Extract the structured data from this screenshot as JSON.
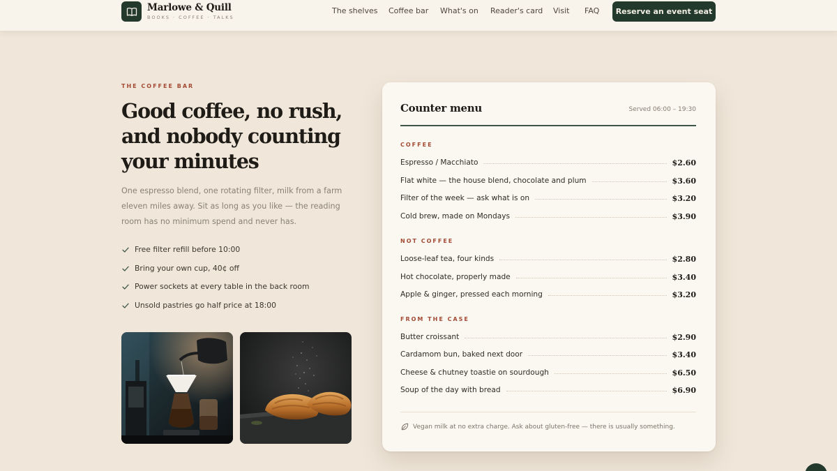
{
  "header": {
    "brand_name": "Marlowe & Quill",
    "brand_tagline": "BOOKS · COFFEE · TALKS",
    "brand_icon": "book-icon",
    "nav": [
      {
        "label": "The shelves"
      },
      {
        "label": "Coffee bar"
      },
      {
        "label": "What's on"
      },
      {
        "label": "Reader's card"
      },
      {
        "label": "Visit"
      },
      {
        "label": "FAQ"
      }
    ],
    "cta_label": "Reserve an event seat"
  },
  "hero": {
    "eyebrow": "THE COFFEE BAR",
    "headline": "Good coffee, no rush, and nobody counting your minutes",
    "lede": "One espresso blend, one rotating filter, milk from a farm eleven miles away. Sit as long as you like — the reading room has no minimum spend and never has.",
    "perks": [
      "Free filter refill before 10:00",
      "Bring your own cup, 40¢ off",
      "Power sockets at every table in the back room",
      "Unsold pastries go half price at 18:00"
    ],
    "photos": [
      "pour-over-coffee-photo",
      "croissants-photo"
    ]
  },
  "menu": {
    "title": "Counter menu",
    "hours": "Served 06:00 – 19:30",
    "sections": [
      {
        "title": "COFFEE",
        "items": [
          {
            "name": "Espresso / Macchiato",
            "price": "$2.60"
          },
          {
            "name": "Flat white — the house blend, chocolate and plum",
            "price": "$3.60"
          },
          {
            "name": "Filter of the week — ask what is on",
            "price": "$3.20"
          },
          {
            "name": "Cold brew, made on Mondays",
            "price": "$3.90"
          }
        ]
      },
      {
        "title": "NOT COFFEE",
        "items": [
          {
            "name": "Loose-leaf tea, four kinds",
            "price": "$2.80"
          },
          {
            "name": "Hot chocolate, properly made",
            "price": "$3.40"
          },
          {
            "name": "Apple & ginger, pressed each morning",
            "price": "$3.20"
          }
        ]
      },
      {
        "title": "FROM THE CASE",
        "items": [
          {
            "name": "Butter croissant",
            "price": "$2.90"
          },
          {
            "name": "Cardamom bun, baked next door",
            "price": "$3.40"
          },
          {
            "name": "Cheese & chutney toastie on sourdough",
            "price": "$6.50"
          },
          {
            "name": "Soup of the day with bread",
            "price": "$6.90"
          }
        ]
      }
    ],
    "note": "Vegan milk at no extra charge. Ask about gluten-free — there is usually something."
  },
  "colors": {
    "background": "#f0e7da",
    "brand_green": "#22392c",
    "accent_rust": "#a34a34",
    "card": "#fbf8f1"
  }
}
